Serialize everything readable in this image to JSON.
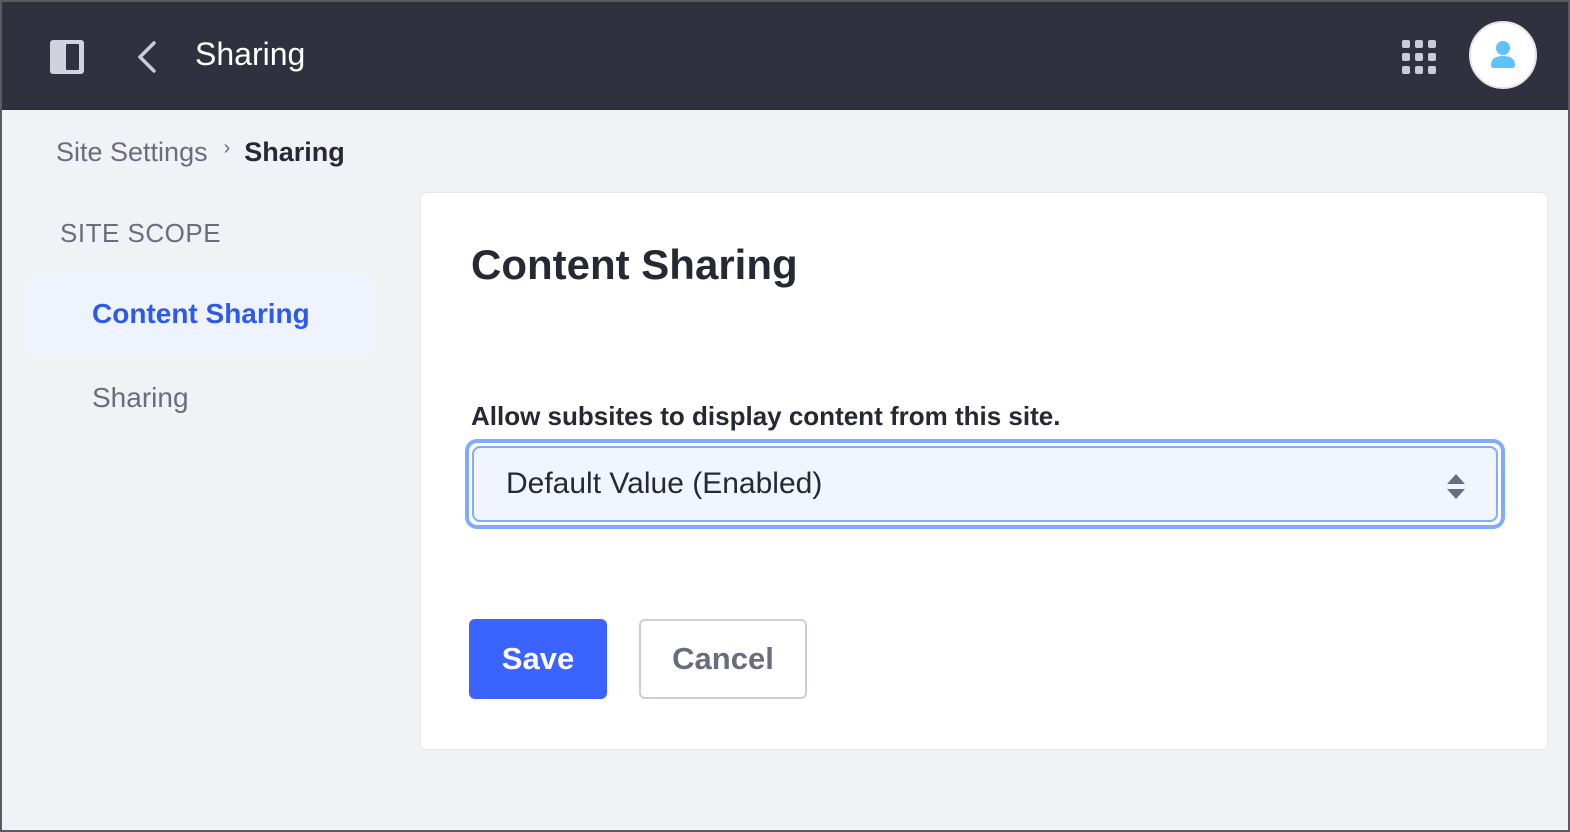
{
  "topbar": {
    "title": "Sharing",
    "icons": [
      "sidebar-panel-icon",
      "back-chevron-icon",
      "apps-grid-icon",
      "user-avatar-icon"
    ]
  },
  "breadcrumb": {
    "items": [
      {
        "label": "Site Settings"
      },
      {
        "label": "Sharing"
      }
    ],
    "separator": "›"
  },
  "sidebar": {
    "heading": "SITE SCOPE",
    "items": [
      {
        "label": "Content Sharing",
        "active": true
      },
      {
        "label": "Sharing",
        "active": false
      }
    ]
  },
  "main": {
    "title": "Content Sharing",
    "field": {
      "label": "Allow subsites to display content from this site.",
      "selected_value": "Default Value (Enabled)"
    },
    "buttons": {
      "save_label": "Save",
      "cancel_label": "Cancel"
    }
  },
  "colors": {
    "topbar": "#2f313f",
    "primary": "#3a63ff",
    "active_nav_text": "#2e5aeb",
    "avatar_icon": "#5fc2ff",
    "focus_ring": "#80acff"
  }
}
